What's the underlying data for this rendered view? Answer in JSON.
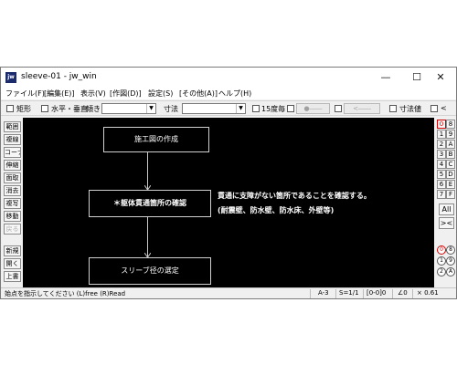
{
  "window": {
    "icon_text": "jw",
    "title": "sleeve-01 - jw_win",
    "min_symbol": "—",
    "max_symbol": "☐",
    "close_symbol": "✕"
  },
  "menubar": [
    "ファイル(F)",
    "[編集(E)]",
    "表示(V)",
    "[作図(D)]",
    "設定(S)",
    "[その他(A)]",
    "ヘルプ(H)"
  ],
  "toolbar": {
    "rect_label": "矩形",
    "horiz_label": "水平・垂直",
    "slope_label": "傾き",
    "dim_label": "寸法",
    "angle_label": "15度毎",
    "btn_forward": "●――",
    "btn_back": "<――",
    "dimvalue_label": "寸法値",
    "lt_label": "<"
  },
  "left_tools": [
    "範囲",
    "複線",
    "コーナー",
    "伸縮",
    "面取",
    "消去",
    "複写",
    "移動",
    "戻る",
    "新規",
    "開く",
    "上書"
  ],
  "canvas": {
    "box1": "施工図の作成",
    "box2": "＊躯体貫通箇所の確認",
    "box3": "スリーブ径の選定",
    "note_line1": "貫通に支障がない箇所であることを確認する。",
    "note_line2": "(耐震壁、防水壁、防水床、外壁等)"
  },
  "right_panel": {
    "layer_pairs": [
      [
        "0",
        "8"
      ],
      [
        "1",
        "9"
      ],
      [
        "2",
        "A"
      ],
      [
        "3",
        "B"
      ],
      [
        "4",
        "C"
      ],
      [
        "5",
        "D"
      ],
      [
        "6",
        "E"
      ],
      [
        "7",
        "F"
      ]
    ],
    "all_label": "All",
    "swap_label": "><",
    "group_pairs": [
      [
        "0",
        "8"
      ],
      [
        "1",
        "9"
      ],
      [
        "2",
        "A"
      ]
    ]
  },
  "statusbar": {
    "message": "始点を指示してください (L)free (R)Read",
    "scale": "A-3",
    "ratio": "S=1/1",
    "layer": "[0-0]0",
    "angle": "∠0",
    "zoom": "× 0.61"
  }
}
